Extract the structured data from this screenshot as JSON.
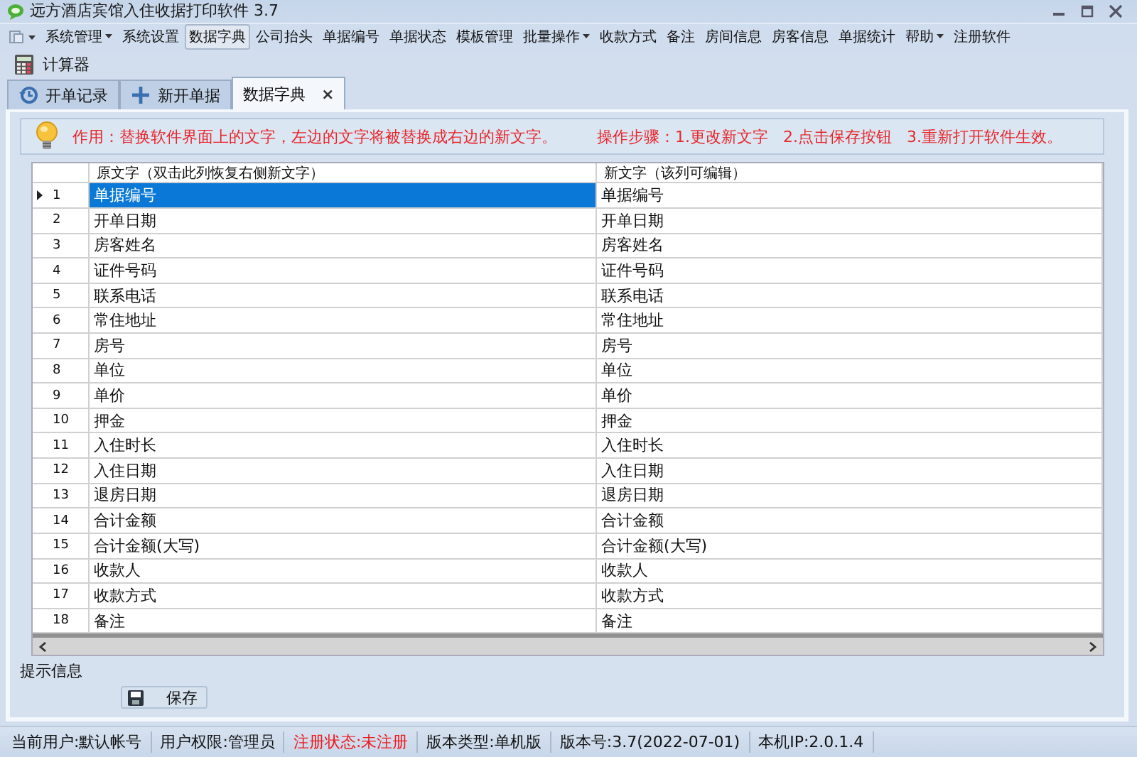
{
  "window": {
    "title": "远方酒店宾馆入住收据打印软件 3.7"
  },
  "menu": [
    {
      "label": "系统管理",
      "dropdown": true,
      "selected": false
    },
    {
      "label": "系统设置",
      "dropdown": false,
      "selected": false
    },
    {
      "label": "数据字典",
      "dropdown": false,
      "selected": true
    },
    {
      "label": "公司抬头",
      "dropdown": false,
      "selected": false
    },
    {
      "label": "单据编号",
      "dropdown": false,
      "selected": false
    },
    {
      "label": "单据状态",
      "dropdown": false,
      "selected": false
    },
    {
      "label": "模板管理",
      "dropdown": false,
      "selected": false
    },
    {
      "label": "批量操作",
      "dropdown": true,
      "selected": false
    },
    {
      "label": "收款方式",
      "dropdown": false,
      "selected": false
    },
    {
      "label": "备注",
      "dropdown": false,
      "selected": false
    },
    {
      "label": "房间信息",
      "dropdown": false,
      "selected": false
    },
    {
      "label": "房客信息",
      "dropdown": false,
      "selected": false
    },
    {
      "label": "单据统计",
      "dropdown": false,
      "selected": false
    },
    {
      "label": "帮助",
      "dropdown": true,
      "selected": false
    },
    {
      "label": "注册软件",
      "dropdown": false,
      "selected": false
    }
  ],
  "toolbar": [
    {
      "label": "计算器"
    }
  ],
  "tabs": [
    {
      "label": "开单记录",
      "kind": "history",
      "selected": false
    },
    {
      "label": "新开单据",
      "kind": "new",
      "selected": false
    },
    {
      "label": "数据字典",
      "kind": "plain",
      "selected": true,
      "close": "×"
    }
  ],
  "info": {
    "purpose": "作用：替换软件界面上的文字，左边的文字将被替换成右边的新文字。",
    "steps": "操作步骤：1.更改新文字   2.点击保存按钮   3.重新打开软件生效。"
  },
  "table": {
    "columns": [
      "原文字（双击此列恢复右侧新文字）",
      "新文字（该列可编辑）"
    ],
    "rows": [
      {
        "number": "1",
        "original": "单据编号",
        "new": "单据编号",
        "selected": true
      },
      {
        "number": "2",
        "original": "开单日期",
        "new": "开单日期",
        "selected": false
      },
      {
        "number": "3",
        "original": "房客姓名",
        "new": "房客姓名",
        "selected": false
      },
      {
        "number": "4",
        "original": "证件号码",
        "new": "证件号码",
        "selected": false
      },
      {
        "number": "5",
        "original": "联系电话",
        "new": "联系电话",
        "selected": false
      },
      {
        "number": "6",
        "original": "常住地址",
        "new": "常住地址",
        "selected": false
      },
      {
        "number": "7",
        "original": "房号",
        "new": "房号",
        "selected": false
      },
      {
        "number": "8",
        "original": "单位",
        "new": "单位",
        "selected": false
      },
      {
        "number": "9",
        "original": "单价",
        "new": "单价",
        "selected": false
      },
      {
        "number": "10",
        "original": "押金",
        "new": "押金",
        "selected": false
      },
      {
        "number": "11",
        "original": "入住时长",
        "new": "入住时长",
        "selected": false
      },
      {
        "number": "12",
        "original": "入住日期",
        "new": "入住日期",
        "selected": false
      },
      {
        "number": "13",
        "original": "退房日期",
        "new": "退房日期",
        "selected": false
      },
      {
        "number": "14",
        "original": "合计金额",
        "new": "合计金额",
        "selected": false
      },
      {
        "number": "15",
        "original": "合计金额(大写)",
        "new": "合计金额(大写)",
        "selected": false
      },
      {
        "number": "16",
        "original": "收款人",
        "new": "收款人",
        "selected": false
      },
      {
        "number": "17",
        "original": "收款方式",
        "new": "收款方式",
        "selected": false
      },
      {
        "number": "18",
        "original": "备注",
        "new": "备注",
        "selected": false
      }
    ]
  },
  "hint_label": "提示信息",
  "save_button": "保存",
  "status_bar": [
    {
      "text": "当前用户:默认帐号",
      "alert": false
    },
    {
      "text": "用户权限:管理员",
      "alert": false
    },
    {
      "text": "注册状态:未注册",
      "alert": true
    },
    {
      "text": "版本类型:单机版",
      "alert": false
    },
    {
      "text": "版本号:3.7(2022-07-01)",
      "alert": false
    },
    {
      "text": "本机IP:2.0.1.4",
      "alert": false
    }
  ]
}
